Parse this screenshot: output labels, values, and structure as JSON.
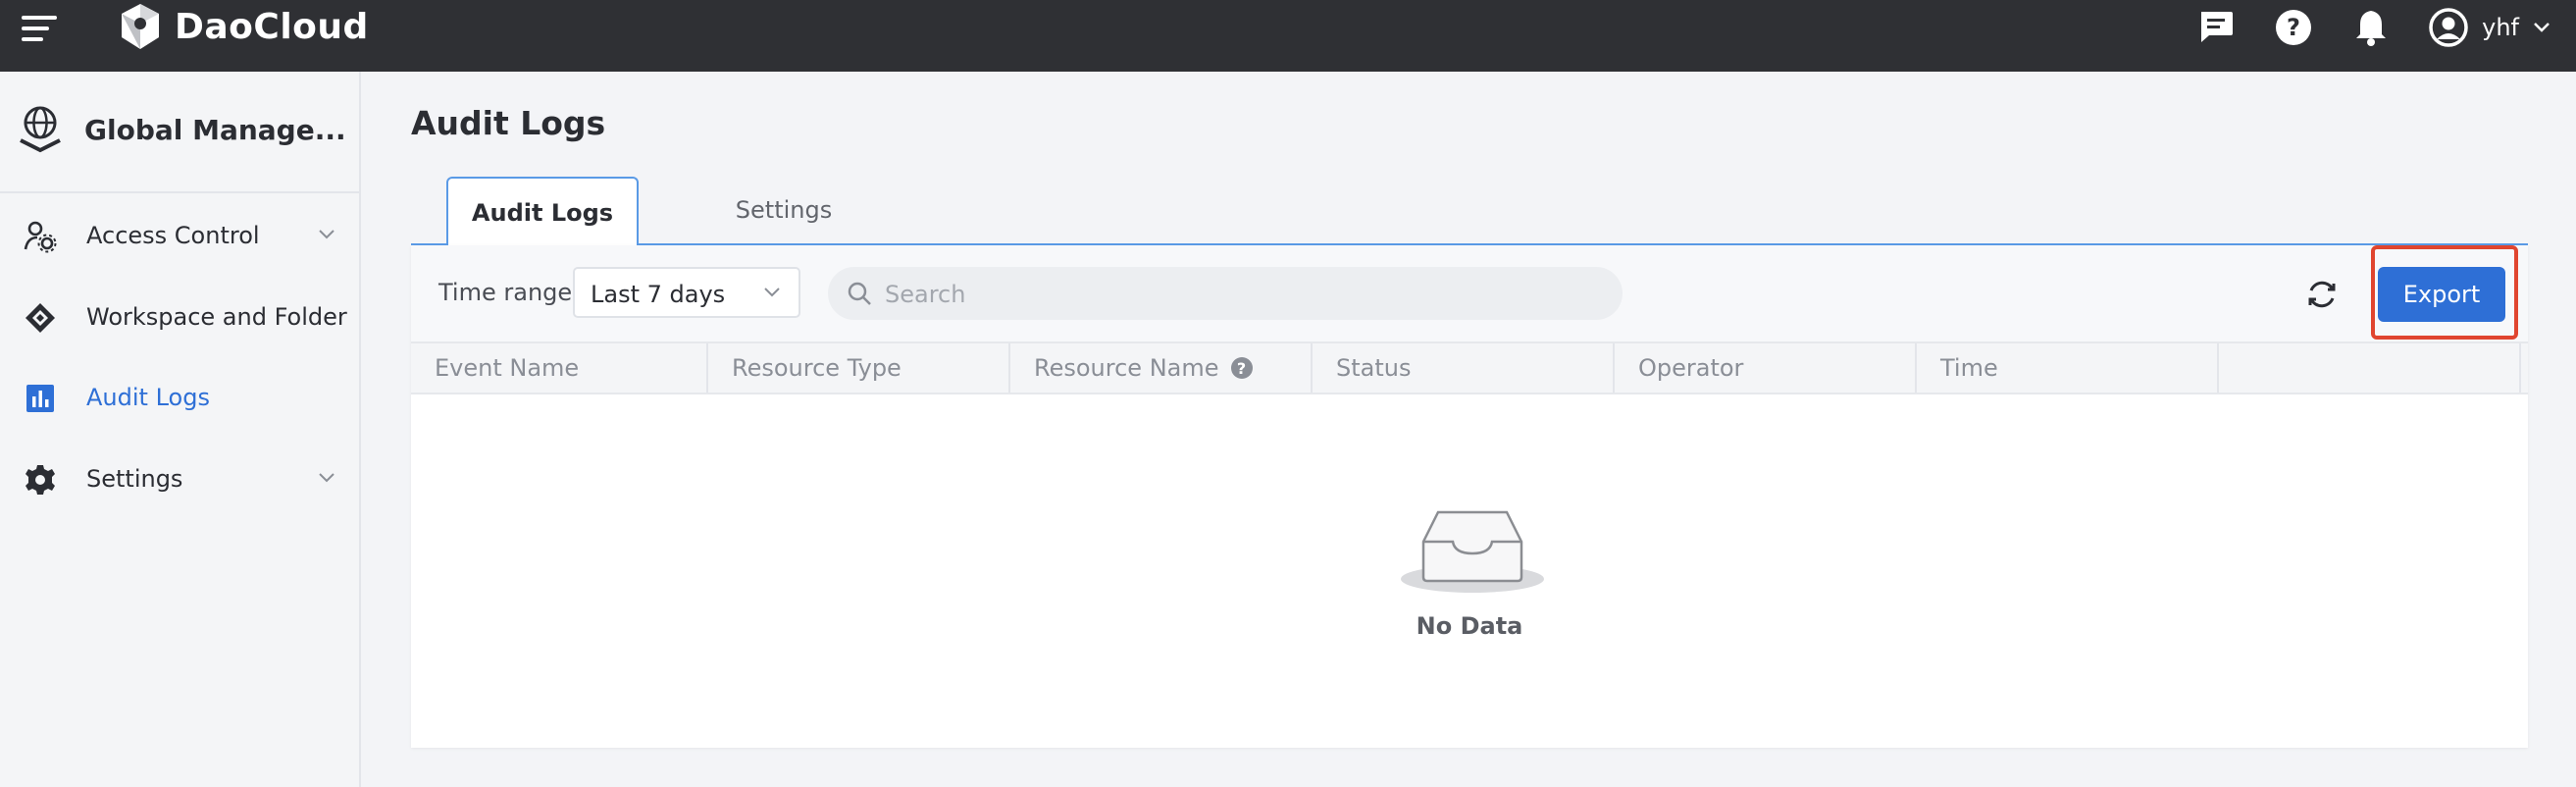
{
  "header": {
    "logo_text": "DaoCloud",
    "user_name": "yhf",
    "icons": [
      "menu-icon",
      "chat-icon",
      "help-icon",
      "bell-icon",
      "user-avatar-icon",
      "chevron-down-icon"
    ]
  },
  "sidebar": {
    "module_title": "Global Manage...",
    "items": [
      {
        "label": "Access Control",
        "icon": "user-gear-icon",
        "expandable": true
      },
      {
        "label": "Workspace and Folder",
        "icon": "workspace-icon",
        "expandable": false
      },
      {
        "label": "Audit Logs",
        "icon": "bar-chart-icon",
        "expandable": false,
        "active": true
      },
      {
        "label": "Settings",
        "icon": "gear-icon",
        "expandable": true
      }
    ]
  },
  "main": {
    "title": "Audit Logs",
    "tabs": [
      {
        "label": "Audit Logs",
        "active": true
      },
      {
        "label": "Settings",
        "active": false
      }
    ],
    "toolbar": {
      "time_range_label": "Time range",
      "time_range_value": "Last 7 days",
      "search_placeholder": "Search",
      "export_label": "Export"
    },
    "table": {
      "columns": [
        "Event Name",
        "Resource Type",
        "Resource Name",
        "Status",
        "Operator",
        "Time",
        ""
      ],
      "rows": [],
      "empty_text": "No Data"
    }
  },
  "colors": {
    "topbar": "#2f3034",
    "accent": "#2e6fd6",
    "highlight": "#e0452f"
  }
}
